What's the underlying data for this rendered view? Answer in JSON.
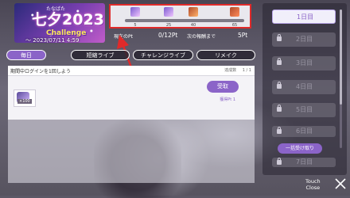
{
  "banner": {
    "kana": "たなばた",
    "title": "七夕2023",
    "subtitle": "Challenge",
    "date": "～ 2023/07/11 4:59"
  },
  "progress": {
    "ticks": [
      "5",
      "25",
      "40",
      "65"
    ],
    "current_label": "現在のPt",
    "current_value": "0/12Pt",
    "next_label": "次の報酬まで",
    "next_value": "5Pt"
  },
  "tabs": [
    {
      "label": "毎日",
      "active": true
    },
    {
      "label": "短縮ライブ",
      "active": false
    },
    {
      "label": "チャレンジライブ",
      "active": false
    },
    {
      "label": "リメイク",
      "active": false
    }
  ],
  "mission": {
    "title": "期間中ログインを1回しよう",
    "progress_label": "達成数",
    "progress_value": "1 / 1",
    "reward_count": "×100",
    "claim_label": "受取",
    "claim_note": "獲得Pt 1"
  },
  "days": [
    {
      "label": "1日目",
      "active": true,
      "locked": false
    },
    {
      "label": "2日目",
      "active": false,
      "locked": true
    },
    {
      "label": "3日目",
      "active": false,
      "locked": true
    },
    {
      "label": "4日目",
      "active": false,
      "locked": true
    },
    {
      "label": "5日目",
      "active": false,
      "locked": true
    },
    {
      "label": "6日目",
      "active": false,
      "locked": true
    },
    {
      "label": "7日目",
      "active": false,
      "locked": true
    }
  ],
  "claim_all_label": "一括受け取り",
  "touch_close": {
    "line1": "Touch",
    "line2": "Close"
  },
  "colors": {
    "accent": "#8b64c8",
    "highlight": "#e02a2a"
  },
  "icons": {
    "lock": "lock-icon",
    "close": "close-icon",
    "reward": "reward-item-icon"
  }
}
